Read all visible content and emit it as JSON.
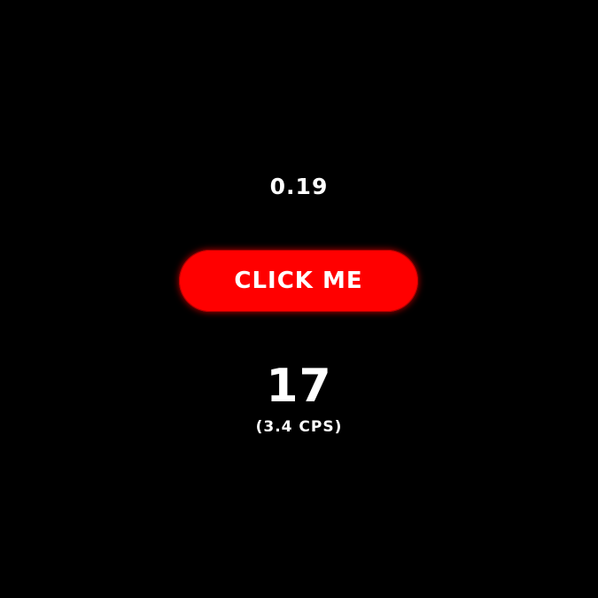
{
  "timer": {
    "value": "0.19"
  },
  "button": {
    "label": "CLICK ME",
    "color": "#ff0000"
  },
  "stats": {
    "clicks": "17",
    "cps": "(3.4 CPS)"
  },
  "theme": {
    "background": "#000000",
    "text": "#ffffff"
  }
}
